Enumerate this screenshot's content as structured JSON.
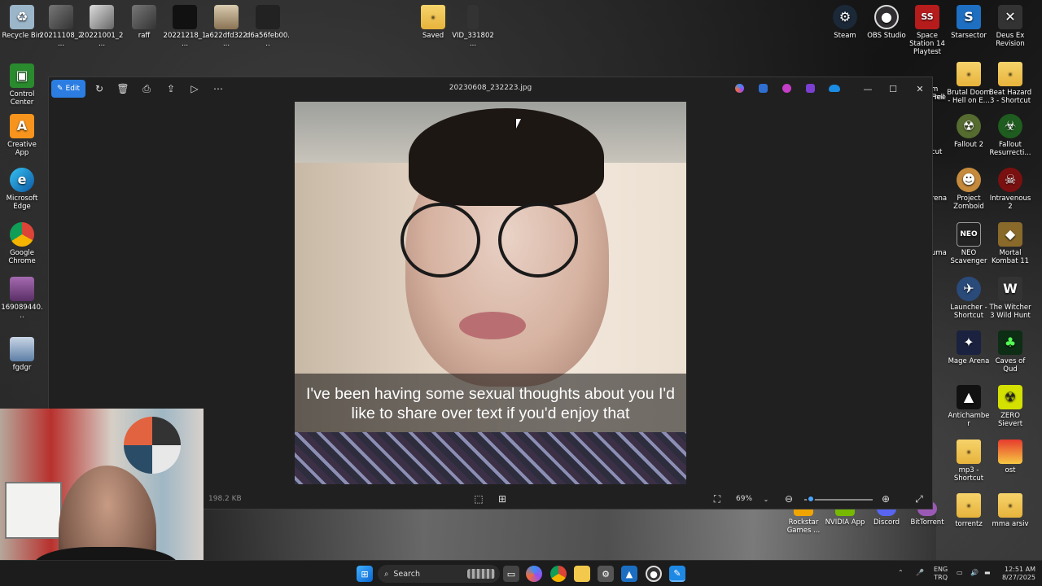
{
  "desktop": {
    "icons_left": [
      {
        "label": "Recycle Bin",
        "icon": "recycle-bin-icon"
      },
      {
        "label": "20211108_2...",
        "icon": "image-thumbnail-icon"
      },
      {
        "label": "20221001_2...",
        "icon": "image-thumbnail-icon"
      },
      {
        "label": "raff",
        "icon": "image-thumbnail-icon"
      },
      {
        "label": "20221218_1...",
        "icon": "image-thumbnail-icon"
      },
      {
        "label": "a622dfd322...",
        "icon": "image-thumbnail-icon"
      },
      {
        "label": "d6a56feb00...",
        "icon": "image-thumbnail-icon"
      },
      {
        "label": "Saved",
        "icon": "folder-icon"
      },
      {
        "label": "VID_331802...",
        "icon": "video-file-icon"
      }
    ],
    "icons_column": [
      {
        "label": "Control Center",
        "icon": "control-center-icon"
      },
      {
        "label": "Creative App",
        "icon": "creative-app-icon"
      },
      {
        "label": "Microsoft Edge",
        "icon": "edge-icon"
      },
      {
        "label": "Google Chrome",
        "icon": "chrome-icon"
      },
      {
        "label": "169089440...",
        "icon": "image-thumbnail-icon"
      },
      {
        "label": "fgdgr",
        "icon": "image-thumbnail-icon"
      }
    ],
    "icons_right_top": [
      {
        "label": "Steam",
        "icon": "steam-icon"
      },
      {
        "label": "OBS Studio",
        "icon": "obs-icon"
      },
      {
        "label": "Space Station 14 Playtest",
        "icon": "space-station-icon"
      },
      {
        "label": "Starsector",
        "icon": "starsector-icon"
      },
      {
        "label": "Deus Ex Revision",
        "icon": "deus-ex-icon"
      }
    ],
    "icons_right_a": [
      {
        "label": "Brutal Doom - Hell on E...",
        "icon": "folder-icon"
      },
      {
        "label": "Fallout 2",
        "icon": "fallout-icon"
      },
      {
        "label": "Project Zomboid",
        "icon": "zomboid-icon"
      },
      {
        "label": "NEO Scavenger",
        "icon": "neo-scavenger-icon"
      },
      {
        "label": "Launcher - Shortcut",
        "icon": "launcher-icon"
      },
      {
        "label": "Mage Arena",
        "icon": "mage-arena-icon"
      },
      {
        "label": "Antichamber",
        "icon": "antichamber-icon"
      },
      {
        "label": "mp3 - Shortcut",
        "icon": "folder-icon"
      },
      {
        "label": "torrentz",
        "icon": "folder-icon"
      }
    ],
    "icons_right_b": [
      {
        "label": "Beat Hazard 3 - Shortcut",
        "icon": "folder-icon"
      },
      {
        "label": "Fallout Resurrecti...",
        "icon": "fallout-resurrection-icon"
      },
      {
        "label": "Intravenous 2",
        "icon": "intravenous-icon"
      },
      {
        "label": "Mortal Kombat 11",
        "icon": "mortal-kombat-icon"
      },
      {
        "label": "The Witcher 3 Wild Hunt",
        "icon": "witcher-icon"
      },
      {
        "label": "Caves of Qud",
        "icon": "caves-of-qud-icon"
      },
      {
        "label": "ZERO Sievert",
        "icon": "zero-sievert-icon"
      },
      {
        "label": "ost",
        "icon": "folder-icon"
      },
      {
        "label": "mma arsiv",
        "icon": "folder-icon"
      }
    ],
    "icons_bottom": [
      {
        "label": "Rockstar Games ...",
        "icon": "rockstar-icon"
      },
      {
        "label": "NVIDIA App",
        "icon": "nvidia-icon"
      },
      {
        "label": "Discord",
        "icon": "discord-icon"
      },
      {
        "label": "BitTorrent",
        "icon": "bittorrent-icon"
      }
    ],
    "partial_labels": [
      "m Free",
      "Hell",
      "cut",
      "rena",
      "uma"
    ]
  },
  "photos_window": {
    "edit_label": "Edit",
    "title": "20230608_232223.jpg",
    "caption": "I've been having some sexual thoughts about you I'd like to share over text if you'd enjoy that",
    "file_size": "198.2 KB",
    "zoom": "69%",
    "zoom_fraction": 0.1
  },
  "taskbar": {
    "search_placeholder": "Search",
    "language": "ENG",
    "layout": "TRQ",
    "time": "12:51 AM",
    "date": "8/27/2025"
  },
  "colors": {
    "accent": "#2b7de1",
    "window_bg": "#202020",
    "taskbar_bg": "#1c1c1c"
  }
}
